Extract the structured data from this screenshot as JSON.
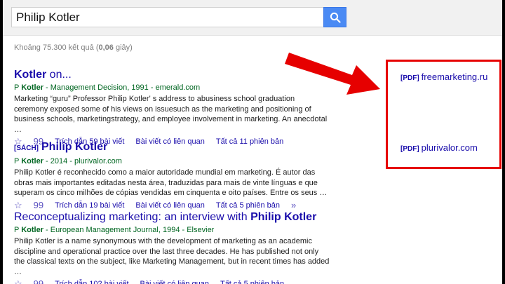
{
  "search": {
    "query": "Philip Kotler"
  },
  "stats": {
    "prefix": "Khoảng 75.300 kết quả (",
    "time": "0,06",
    "suffix": " giây)"
  },
  "results": [
    {
      "tag": "",
      "title_plain": "",
      "title_bold": "Kotler",
      "title_after": " on...",
      "meta_pre": "P ",
      "meta_bold": "Kotler",
      "meta_post": " - Management Decision, 1991 - emerald.com",
      "snippet": "Marketing “guru” Professor Philip Kotler' s address to abusiness school graduation ceremony exposed some of his views on issuesuch as the marketing and positioning of business schools, marketingstrategy, and employee involvement in marketing. An anecdotal …",
      "cited": "Trích dẫn 59 bài viết",
      "related": "Bài viết có liên quan",
      "versions": "Tất cả 11 phiên bản"
    },
    {
      "tag": "[SÁCH]",
      "title_plain": "",
      "title_bold": "Philip Kotler",
      "title_after": "",
      "meta_pre": "P ",
      "meta_bold": "Kotler",
      "meta_post": " - 2014 - plurivalor.com",
      "snippet": "Philip Kotler é reconhecido como a maior autoridade mundial em marketing. É autor das obras mais importantes editadas nesta área, traduzidas para mais de vinte línguas e que superam os cinco milhões de cópias vendidas em cinquenta e oito países. Entre os seus …",
      "cited": "Trích dẫn 19 bài viết",
      "related": "Bài viết có liên quan",
      "versions": "Tất cả 5 phiên bản"
    },
    {
      "tag": "",
      "title_plain": "Reconceptualizing marketing: an interview with ",
      "title_bold": "Philip Kotler",
      "title_after": "",
      "meta_pre": "P ",
      "meta_bold": "Kotler",
      "meta_post": " - European Management Journal, 1994 - Elsevier",
      "snippet": "Philip Kotler is a name synonymous with the development of marketing as an academic discipline and operational practice over the last three decades. He has published not only the classical texts on the subject, like Marketing Management, but in recent times has added …",
      "cited": "Trích dẫn 102 bài viết",
      "related": "Bài viết có liên quan",
      "versions": "Tất cả 5 phiên bản"
    }
  ],
  "side_links": [
    {
      "tag": "[PDF]",
      "label": "freemarketing.ru"
    },
    {
      "tag": "[PDF]",
      "label": "plurivalor.com"
    }
  ],
  "icons": {
    "star": "☆",
    "quote": "99",
    "more": "»"
  },
  "colors": {
    "accent": "#e60000",
    "link": "#1a0dab",
    "meta": "#006621",
    "search_button": "#4a8af4"
  }
}
